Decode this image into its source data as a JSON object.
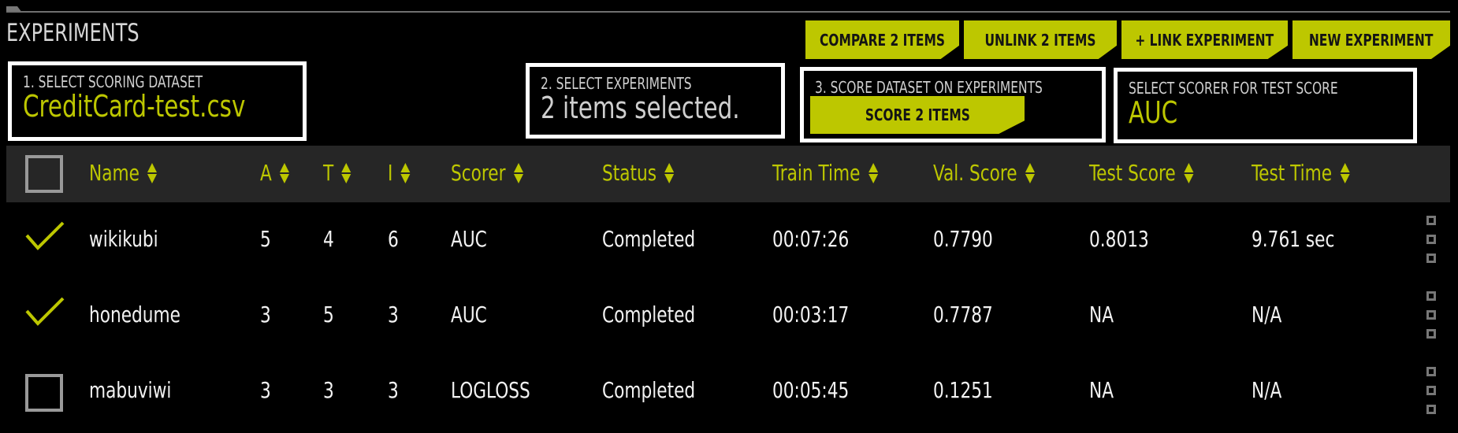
{
  "page": {
    "title": "EXPERIMENTS"
  },
  "colors": {
    "accent": "#bdc700",
    "header_bg": "#262626",
    "background": "#000000",
    "text": "#f2f2f2",
    "muted": "#cfcfcf"
  },
  "toolbar": {
    "compare_label": "COMPARE 2 ITEMS",
    "unlink_label": "UNLINK 2 ITEMS",
    "link_label": "+ LINK EXPERIMENT",
    "new_label": "NEW EXPERIMENT"
  },
  "steps": {
    "dataset": {
      "label": "1. SELECT SCORING DATASET",
      "value": "CreditCard-test.csv"
    },
    "experiments": {
      "label": "2. SELECT EXPERIMENTS",
      "value": "2 items selected."
    },
    "score": {
      "label": "3. SCORE DATASET ON EXPERIMENTS",
      "button": "SCORE 2 ITEMS"
    },
    "scorer": {
      "label": "SELECT SCORER FOR TEST SCORE",
      "value": "AUC"
    }
  },
  "table": {
    "columns": [
      "Name",
      "A",
      "T",
      "I",
      "Scorer",
      "Status",
      "Train Time",
      "Val. Score",
      "Test Score",
      "Test Time"
    ],
    "rows": [
      {
        "selected": true,
        "cells": [
          "wikikubi",
          "5",
          "4",
          "6",
          "AUC",
          "Completed",
          "00:07:26",
          "0.7790",
          "0.8013",
          "9.761 sec"
        ]
      },
      {
        "selected": true,
        "cells": [
          "honedume",
          "3",
          "5",
          "3",
          "AUC",
          "Completed",
          "00:03:17",
          "0.7787",
          "NA",
          "N/A"
        ]
      },
      {
        "selected": false,
        "cells": [
          "mabuviwi",
          "3",
          "3",
          "3",
          "LOGLOSS",
          "Completed",
          "00:05:45",
          "0.1251",
          "NA",
          "N/A"
        ]
      }
    ]
  }
}
